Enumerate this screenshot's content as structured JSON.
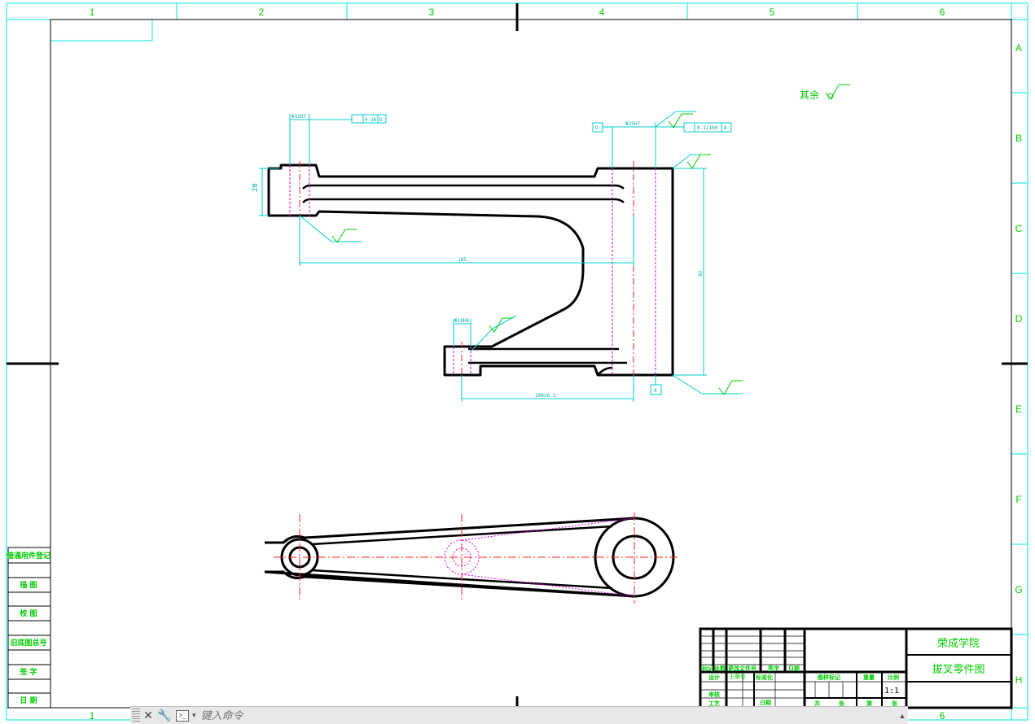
{
  "frame": {
    "columns": [
      "1",
      "2",
      "3",
      "4",
      "5",
      "6"
    ],
    "rows": [
      "A",
      "B",
      "C",
      "D",
      "E",
      "F",
      "G",
      "H"
    ]
  },
  "drawing": {
    "surface_note": "其余",
    "dims": {
      "bore_top_left": "Φ12H7",
      "parallel_tol": "0.16",
      "parallel_datum": "D",
      "datum_d": "D",
      "bore_top_right": "Φ25H7",
      "perp_tol": "0.1/100",
      "perp_datum": "A",
      "height_28": "28",
      "length_185": "185",
      "height_right": "93",
      "bore_bottom": "Φ10H8",
      "length_100": "100±0.3",
      "datum_a": "A"
    }
  },
  "title_block": {
    "school": "荣成学院",
    "part_name": "拔叉零件图",
    "scale": "1:1",
    "headers": [
      "标记",
      "处数",
      "更改文件号",
      "签字",
      "日期"
    ],
    "design_label": "设计",
    "design_name": "王荣忠",
    "std_label": "标准化",
    "stage_label": "图样标记",
    "weight_label": "重量",
    "ratio_label": "比例",
    "review_label": "审核",
    "process_label": "工艺",
    "date_label": "日期",
    "sheet_labels": [
      "共",
      "张",
      "第",
      "张"
    ]
  },
  "side_table": {
    "rows": [
      "借通用件登记",
      "描 图",
      "校 图",
      "旧底图总号",
      "签 字",
      "日 期"
    ]
  },
  "command_bar": {
    "placeholder": "键入命令",
    "prompt_icon": "command-prompt-icon",
    "close_icon": "close-icon",
    "settings_icon": "wrench-icon"
  }
}
